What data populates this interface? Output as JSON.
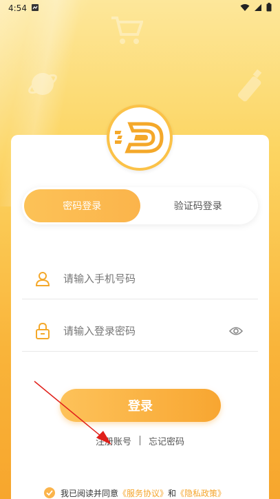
{
  "status_bar": {
    "time": "4:54"
  },
  "tabs": [
    {
      "label": "密码登录",
      "active": true
    },
    {
      "label": "验证码登录",
      "active": false
    }
  ],
  "phone": {
    "placeholder": "请输入手机号码"
  },
  "password": {
    "placeholder": "请输入登录密码"
  },
  "login_button": "登录",
  "links": {
    "register": "注册账号",
    "forgot": "忘记密码"
  },
  "agreement": {
    "prefix": "我已阅读并同意",
    "service": "《服务协议》",
    "and": "和",
    "privacy": "《隐私政策》"
  },
  "colors": {
    "accent": "#fbb44b",
    "link": "#f5a52c"
  }
}
